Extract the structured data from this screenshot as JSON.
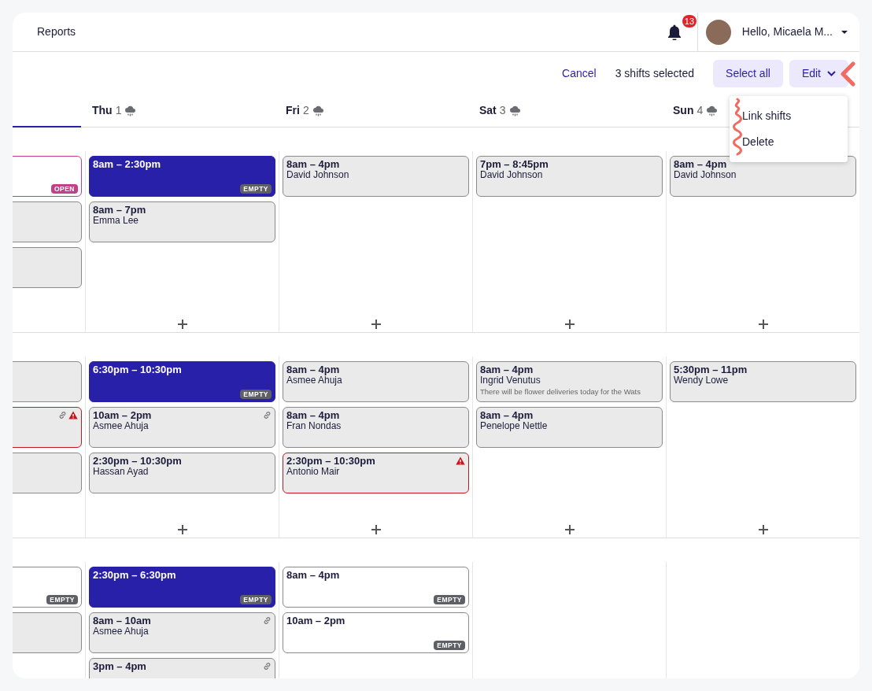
{
  "topbar": {
    "link": "Reports",
    "notification_count": "13",
    "greeting": "Hello, Micaela M..."
  },
  "toolbar": {
    "cancel": "Cancel",
    "selection": "3 shifts selected",
    "select_all": "Select all",
    "edit": "Edit"
  },
  "edit_menu": {
    "expanded": true,
    "items": [
      "Link shifts",
      "Delete"
    ]
  },
  "days": [
    {
      "kind": "partial",
      "underlined": true
    },
    {
      "kind": "day",
      "weekday": "Thu",
      "date": "1",
      "underlined": false
    },
    {
      "kind": "day",
      "weekday": "Fri",
      "date": "2",
      "underlined": false
    },
    {
      "kind": "day",
      "weekday": "Sat",
      "date": "3",
      "underlined": false
    },
    {
      "kind": "day",
      "weekday": "Sun",
      "date": "4",
      "underlined": false
    }
  ],
  "groups": [
    {
      "cells": [
        {
          "shifts": [
            {
              "kind": "open",
              "selected": false,
              "linked": false,
              "warning": false,
              "badge": "OPEN"
            },
            {
              "kind": "assigned",
              "selected": false,
              "linked": false,
              "warning": false
            },
            {
              "kind": "assigned",
              "selected": false,
              "linked": false,
              "warning": false
            }
          ]
        },
        {
          "add_button": true,
          "shifts": [
            {
              "kind": "unassigned",
              "selected": true,
              "linked": false,
              "warning": false,
              "time": "8am – 2:30pm",
              "badge": "EMPTY"
            },
            {
              "kind": "assigned",
              "selected": false,
              "linked": false,
              "warning": false,
              "time": "8am – 7pm",
              "name": "Emma Lee"
            }
          ]
        },
        {
          "add_button": true,
          "shifts": [
            {
              "kind": "assigned",
              "selected": false,
              "linked": false,
              "warning": false,
              "time": "8am – 4pm",
              "name": "David Johnson"
            }
          ]
        },
        {
          "add_button": true,
          "shifts": [
            {
              "kind": "assigned",
              "selected": false,
              "linked": false,
              "warning": false,
              "time": "7pm – 8:45pm",
              "name": "David Johnson"
            }
          ]
        },
        {
          "add_button": true,
          "shifts": [
            {
              "kind": "assigned",
              "selected": false,
              "linked": false,
              "warning": false,
              "time": "8am – 4pm",
              "name": "David Johnson"
            }
          ]
        }
      ]
    },
    {
      "cells": [
        {
          "shifts": [
            {
              "kind": "assigned",
              "selected": false,
              "linked": false,
              "warning": false
            },
            {
              "kind": "assigned",
              "selected": false,
              "linked": true,
              "warning": true
            },
            {
              "kind": "assigned",
              "selected": false,
              "linked": false,
              "warning": false
            }
          ]
        },
        {
          "add_button": true,
          "shifts": [
            {
              "kind": "unassigned",
              "selected": true,
              "linked": false,
              "warning": false,
              "time": "6:30pm – 10:30pm",
              "badge": "EMPTY"
            },
            {
              "kind": "assigned",
              "selected": false,
              "linked": true,
              "warning": false,
              "time": "10am – 2pm",
              "name": "Asmee Ahuja"
            },
            {
              "kind": "assigned",
              "selected": false,
              "linked": false,
              "warning": false,
              "time": "2:30pm – 10:30pm",
              "name": "Hassan Ayad"
            }
          ]
        },
        {
          "add_button": true,
          "shifts": [
            {
              "kind": "assigned",
              "selected": false,
              "linked": false,
              "warning": false,
              "time": "8am – 4pm",
              "name": "Asmee Ahuja"
            },
            {
              "kind": "assigned",
              "selected": false,
              "linked": false,
              "warning": false,
              "time": "8am – 4pm",
              "name": "Fran Nondas"
            },
            {
              "kind": "assigned",
              "selected": false,
              "linked": false,
              "warning": true,
              "time": "2:30pm – 10:30pm",
              "name": "Antonio Mair"
            }
          ]
        },
        {
          "add_button": true,
          "shifts": [
            {
              "kind": "assigned",
              "selected": false,
              "linked": false,
              "warning": false,
              "time": "8am – 4pm",
              "name": "Ingrid Venutus",
              "note": "There will be flower deliveries today for the Wats"
            },
            {
              "kind": "assigned",
              "selected": false,
              "linked": false,
              "warning": false,
              "time": "8am – 4pm",
              "name": "Penelope Nettle"
            }
          ]
        },
        {
          "add_button": true,
          "shifts": [
            {
              "kind": "assigned",
              "selected": false,
              "linked": false,
              "warning": false,
              "time": "5:30pm – 11pm",
              "name": "Wendy Lowe"
            }
          ]
        }
      ]
    },
    {
      "cells": [
        {
          "shifts": [
            {
              "kind": "unassigned",
              "selected": false,
              "linked": false,
              "warning": false,
              "badge": "EMPTY"
            },
            {
              "kind": "assigned",
              "selected": false,
              "linked": false,
              "warning": false
            }
          ]
        },
        {
          "shifts": [
            {
              "kind": "unassigned",
              "selected": true,
              "linked": false,
              "warning": false,
              "time": "2:30pm – 6:30pm",
              "badge": "EMPTY"
            },
            {
              "kind": "assigned",
              "selected": false,
              "linked": true,
              "warning": false,
              "time": "8am – 10am",
              "name": "Asmee Ahuja"
            },
            {
              "kind": "assigned",
              "selected": false,
              "linked": true,
              "warning": false,
              "time": "3pm – 4pm"
            }
          ]
        },
        {
          "shifts": [
            {
              "kind": "unassigned",
              "selected": false,
              "linked": false,
              "warning": false,
              "time": "8am – 4pm",
              "badge": "EMPTY"
            },
            {
              "kind": "unassigned",
              "selected": false,
              "linked": false,
              "warning": false,
              "time": "10am – 2pm",
              "badge": "EMPTY"
            }
          ]
        },
        {},
        {}
      ]
    }
  ]
}
